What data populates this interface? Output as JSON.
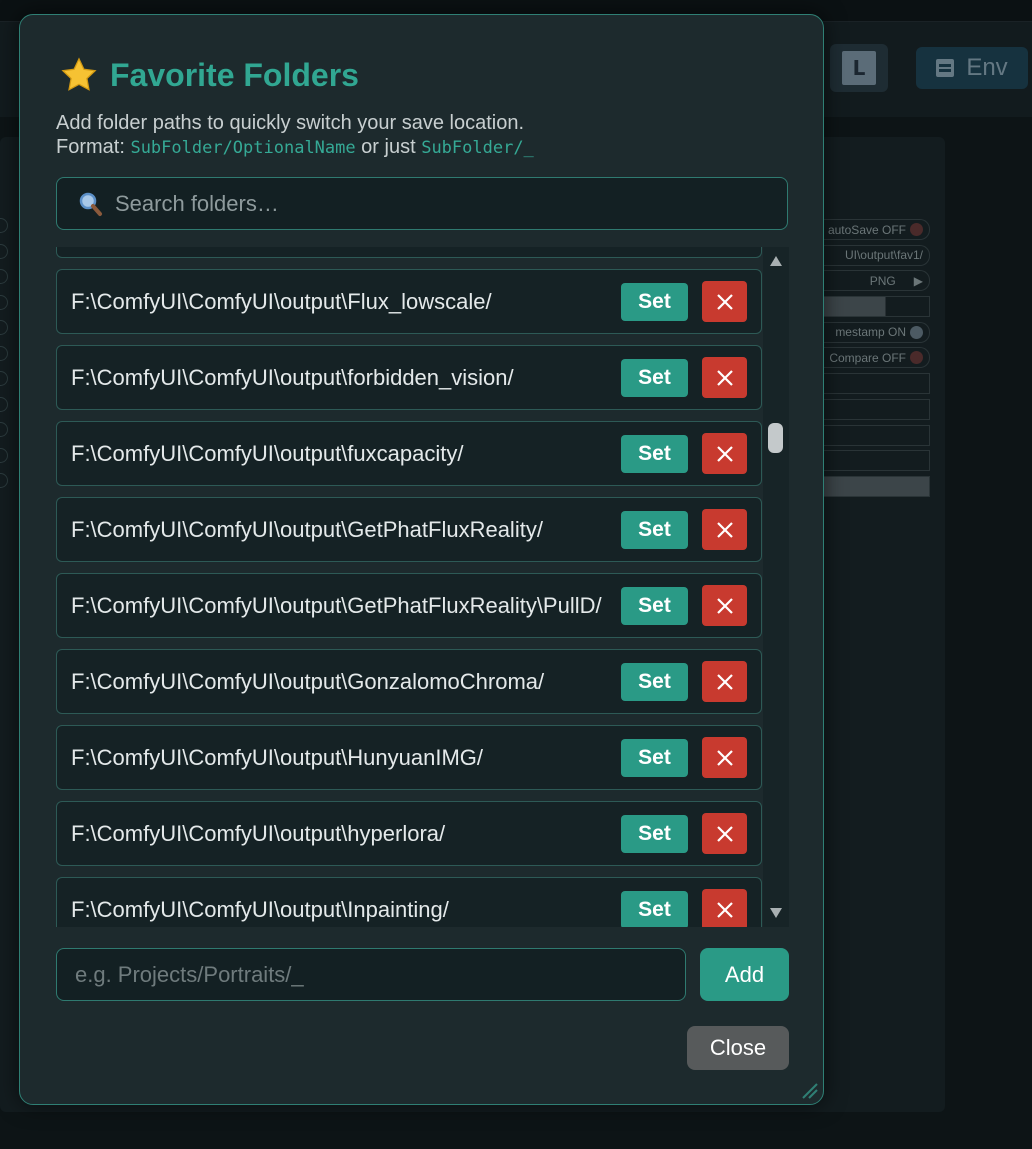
{
  "background": {
    "env_label": "Env",
    "logo_letter": "L",
    "side_rows": [
      "autoSave OFF",
      "UI\\output\\fav1/",
      "PNG",
      "",
      "mestamp ON",
      "Compare OFF",
      "",
      "",
      "",
      "",
      ""
    ]
  },
  "modal": {
    "title": "Favorite Folders",
    "desc_line1": "Add folder paths to quickly switch your save location.",
    "desc_format_prefix": "Format: ",
    "desc_format_code1": "SubFolder/OptionalName",
    "desc_format_mid": " or just ",
    "desc_format_code2": "SubFolder/_",
    "search_placeholder": "Search folders…",
    "set_label": "Set",
    "folders": [
      "F:\\ComfyUI\\ComfyUI\\output\\Flux_lowscale/",
      "F:\\ComfyUI\\ComfyUI\\output\\forbidden_vision/",
      "F:\\ComfyUI\\ComfyUI\\output\\fuxcapacity/",
      "F:\\ComfyUI\\ComfyUI\\output\\GetPhatFluxReality/",
      "F:\\ComfyUI\\ComfyUI\\output\\GetPhatFluxReality\\PullD/",
      "F:\\ComfyUI\\ComfyUI\\output\\GonzalomoChroma/",
      "F:\\ComfyUI\\ComfyUI\\output\\HunyuanIMG/",
      "F:\\ComfyUI\\ComfyUI\\output\\hyperlora/",
      "F:\\ComfyUI\\ComfyUI\\output\\Inpainting/"
    ],
    "add_placeholder": "e.g. Projects/Portraits/_",
    "add_label": "Add",
    "close_label": "Close"
  },
  "colors": {
    "accent": "#2a9a86",
    "title": "#31a792",
    "danger": "#c83a2f"
  }
}
